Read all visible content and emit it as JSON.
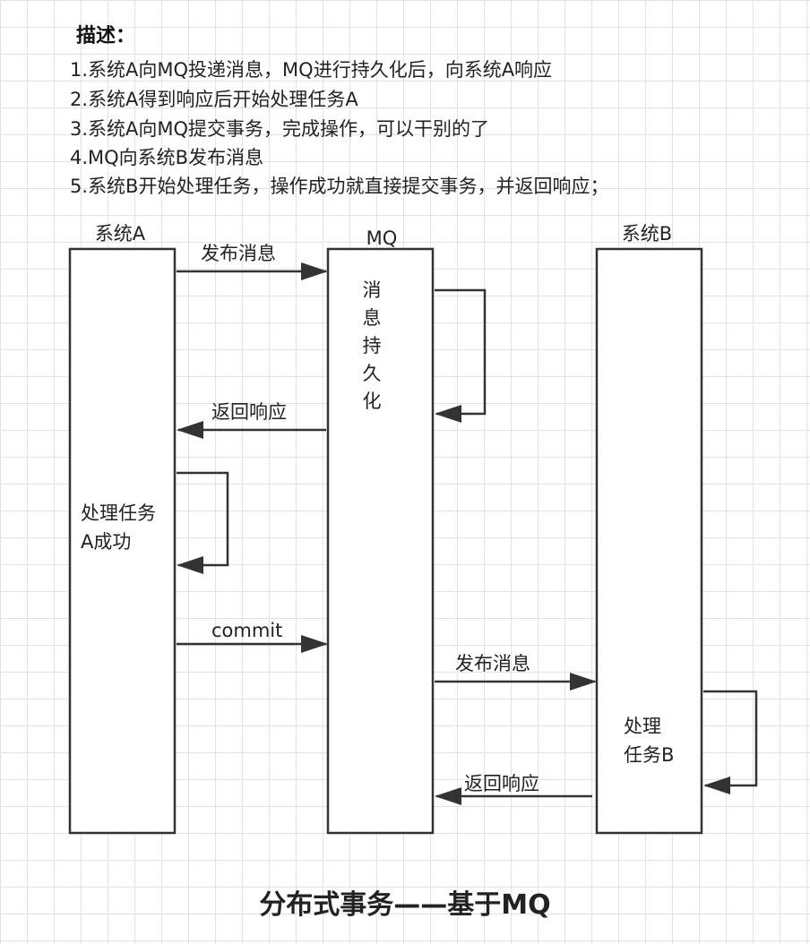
{
  "description": {
    "title": "描述：",
    "steps": [
      "1.系统A向MQ投递消息，MQ进行持久化后，向系统A响应",
      "2.系统A得到响应后开始处理任务A",
      "3.系统A向MQ提交事务，完成操作，可以干别的了",
      "4.MQ向系统B发布消息",
      "5.系统B开始处理任务，操作成功就直接提交事务，并返回响应；"
    ]
  },
  "participants": {
    "a": "系统A",
    "mq": "MQ",
    "b": "系统B"
  },
  "messages": {
    "a_to_mq_publish": "发布消息",
    "mq_to_a_response": "返回响应",
    "a_to_mq_commit": "commit",
    "mq_to_b_publish": "发布消息",
    "b_to_mq_response": "返回响应"
  },
  "self_actions": {
    "mq_persist": [
      "消",
      "息",
      "持",
      "久",
      "化"
    ],
    "a_process": [
      "处理任务",
      "A成功"
    ],
    "b_process": [
      "处理",
      "任务B"
    ]
  },
  "footer": "分布式事务——基于MQ",
  "colors": {
    "line": "#333333",
    "grid": "#e3e3e3",
    "background": "#ffffff"
  }
}
